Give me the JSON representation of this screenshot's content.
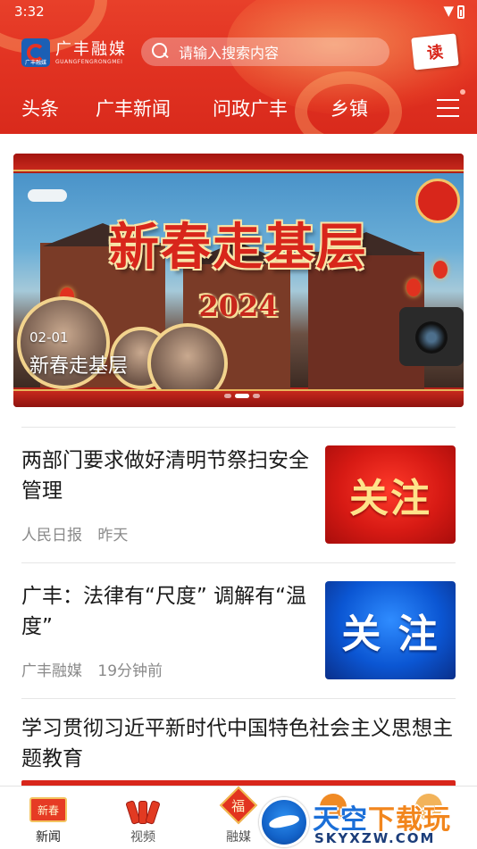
{
  "status_bar": {
    "time": "3:32"
  },
  "header": {
    "brand_name": "广丰融媒",
    "brand_pinyin": "GUANGFENGRONGMEI",
    "logo_caption": "广丰融媒",
    "search_placeholder": "请输入搜索内容",
    "read_badge": "读"
  },
  "nav": {
    "tabs": [
      {
        "label": "头条"
      },
      {
        "label": "广丰新闻"
      },
      {
        "label": "问政广丰"
      },
      {
        "label": "乡镇"
      }
    ],
    "menu_icon": "hamburger-menu-icon"
  },
  "banner": {
    "title": "新春走基层",
    "year": "2024",
    "date": "02-01",
    "caption": "新春走基层",
    "slide_count": 3,
    "active_slide": 2
  },
  "news": [
    {
      "title": "两部门要求做好清明节祭扫安全管理",
      "source": "人民日报",
      "time": "昨天",
      "thumb_text": "关注",
      "thumb_style": "red"
    },
    {
      "title": "广丰：法律有“尺度” 调解有“温度”",
      "source": "广丰融媒",
      "time": "19分钟前",
      "thumb_text": "关 注",
      "thumb_style": "blue"
    },
    {
      "title": "学习贯彻习近平新时代中国特色社会主义思想主题教育"
    }
  ],
  "tabbar": {
    "tabs": [
      {
        "label": "新闻",
        "icon": "spring-festival-icon",
        "icon_text": "新春",
        "active": true
      },
      {
        "label": "视频",
        "icon": "firecracker-icon"
      },
      {
        "label": "融媒",
        "icon": "fu-diamond-icon",
        "icon_text": "福"
      }
    ]
  },
  "watermark": {
    "main_blue": "天空",
    "main_orange": "下载玩",
    "sub": "SKYXZW.COM"
  },
  "colors": {
    "header_red": "#e23322",
    "accent_gold": "#f1c469",
    "text_main": "#1a1a1a",
    "text_meta": "#8a8a8a"
  }
}
